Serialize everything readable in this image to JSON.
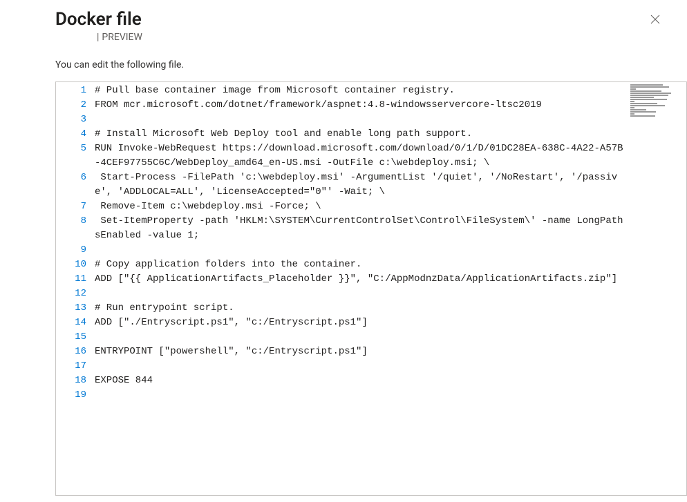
{
  "header": {
    "title": "Docker file",
    "separator": "|",
    "preview_label": "PREVIEW"
  },
  "instruction": "You can edit the following file.",
  "code_lines": [
    {
      "n": 1,
      "text": "# Pull base container image from Microsoft container registry."
    },
    {
      "n": 2,
      "text": "FROM mcr.microsoft.com/dotnet/framework/aspnet:4.8-windowsservercore-ltsc2019"
    },
    {
      "n": 3,
      "text": ""
    },
    {
      "n": 4,
      "text": "# Install Microsoft Web Deploy tool and enable long path support."
    },
    {
      "n": 5,
      "text": "RUN Invoke-WebRequest https://download.microsoft.com/download/0/1/D/01DC28EA-638C-4A22-A57B-4CEF97755C6C/WebDeploy_amd64_en-US.msi -OutFile c:\\webdeploy.msi; \\"
    },
    {
      "n": 6,
      "text": " Start-Process -FilePath 'c:\\webdeploy.msi' -ArgumentList '/quiet', '/NoRestart', '/passive', 'ADDLOCAL=ALL', 'LicenseAccepted=\"0\"' -Wait; \\"
    },
    {
      "n": 7,
      "text": " Remove-Item c:\\webdeploy.msi -Force; \\"
    },
    {
      "n": 8,
      "text": " Set-ItemProperty -path 'HKLM:\\SYSTEM\\CurrentControlSet\\Control\\FileSystem\\' -name LongPathsEnabled -value 1;"
    },
    {
      "n": 9,
      "text": ""
    },
    {
      "n": 10,
      "text": "# Copy application folders into the container."
    },
    {
      "n": 11,
      "text": "ADD [\"{{ ApplicationArtifacts_Placeholder }}\", \"C:/AppModnzData/ApplicationArtifacts.zip\"]"
    },
    {
      "n": 12,
      "text": ""
    },
    {
      "n": 13,
      "text": "# Run entrypoint script."
    },
    {
      "n": 14,
      "text": "ADD [\"./Entryscript.ps1\", \"c:/Entryscript.ps1\"]"
    },
    {
      "n": 15,
      "text": ""
    },
    {
      "n": 16,
      "text": "ENTRYPOINT [\"powershell\", \"c:/Entryscript.ps1\"]"
    },
    {
      "n": 17,
      "text": ""
    },
    {
      "n": 18,
      "text": "EXPOSE 844"
    },
    {
      "n": 19,
      "text": ""
    }
  ]
}
